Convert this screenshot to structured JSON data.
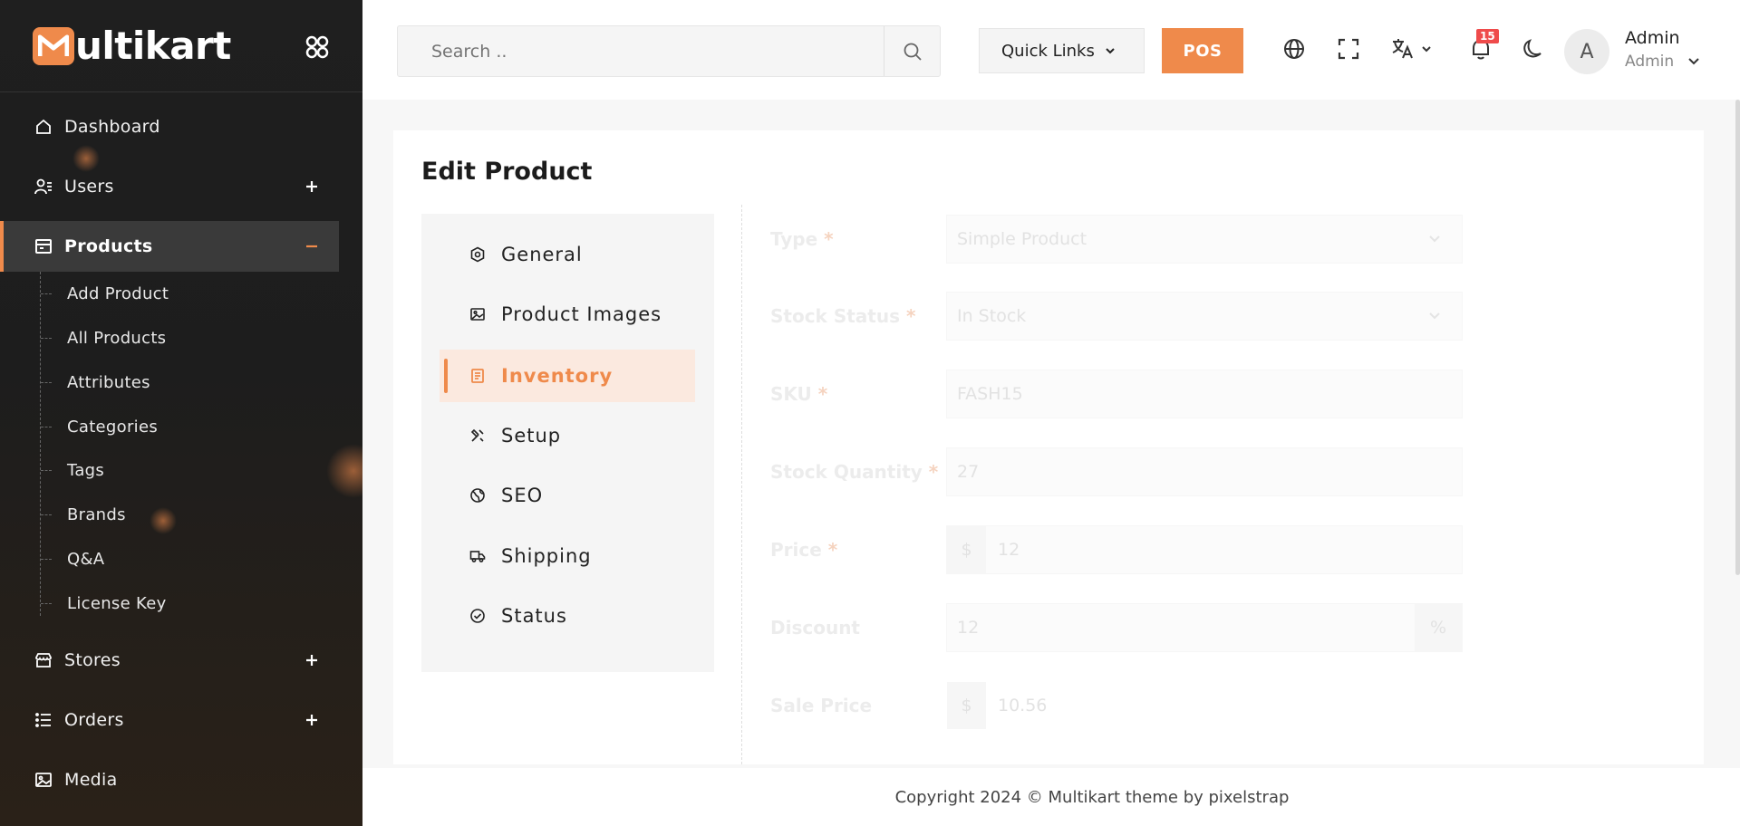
{
  "brand": {
    "logo_letter": "M",
    "logo_rest": "ultikart",
    "accent": "#ef8a4b"
  },
  "sidebar": {
    "items": [
      {
        "label": "Dashboard",
        "icon": "home-icon",
        "expandable": false
      },
      {
        "label": "Users",
        "icon": "users-icon",
        "expandable": true
      },
      {
        "label": "Products",
        "icon": "products-icon",
        "expandable": true,
        "active": true
      },
      {
        "label": "Stores",
        "icon": "store-icon",
        "expandable": true
      },
      {
        "label": "Orders",
        "icon": "list-icon",
        "expandable": true
      },
      {
        "label": "Media",
        "icon": "image-icon",
        "expandable": false
      }
    ],
    "products_sub": [
      "Add Product",
      "All Products",
      "Attributes",
      "Categories",
      "Tags",
      "Brands",
      "Q&A",
      "License Key"
    ]
  },
  "header": {
    "search_placeholder": "Search ..",
    "quick_links": "Quick Links",
    "pos": "POS",
    "notification_count": "15",
    "avatar_initial": "A",
    "user_name": "Admin",
    "user_role": "Admin"
  },
  "page": {
    "title": "Edit Product",
    "tabs": [
      {
        "label": "General",
        "icon": "hexagon-icon"
      },
      {
        "label": "Product Images",
        "icon": "image-icon"
      },
      {
        "label": "Inventory",
        "icon": "inventory-icon",
        "active": true
      },
      {
        "label": "Setup",
        "icon": "tools-icon"
      },
      {
        "label": "SEO",
        "icon": "globe-icon"
      },
      {
        "label": "Shipping",
        "icon": "truck-icon"
      },
      {
        "label": "Status",
        "icon": "check-circle-icon"
      }
    ],
    "form": {
      "type_label": "Type",
      "type_value": "Simple Product",
      "stock_status_label": "Stock Status",
      "stock_status_value": "In Stock",
      "sku_label": "SKU",
      "sku_value": "FASH15",
      "stock_qty_label": "Stock Quantity",
      "stock_qty_value": "27",
      "price_label": "Price",
      "price_prefix": "$",
      "price_value": "12",
      "discount_label": "Discount",
      "discount_value": "12",
      "discount_suffix": "%",
      "sale_price_label": "Sale Price",
      "sale_price_prefix": "$",
      "sale_price_value": "10.56",
      "required_mark": "*"
    }
  },
  "footer": {
    "text": "Copyright 2024 © Multikart theme by pixelstrap"
  }
}
